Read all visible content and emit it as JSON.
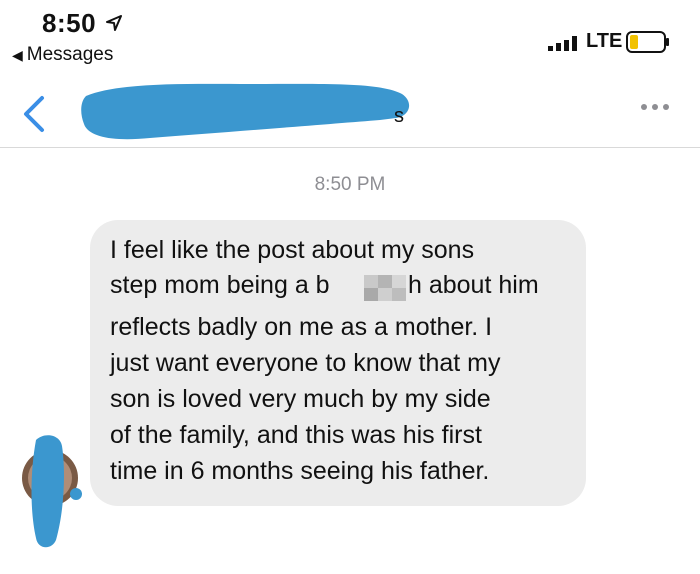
{
  "status_bar": {
    "time": "8:50",
    "back_app": "Messages",
    "carrier": "LTE"
  },
  "nav": {
    "contact_name": "",
    "more_icon": "ellipsis-icon",
    "back_icon": "chevron-left-icon"
  },
  "conversation": {
    "timestamp": "8:50 PM",
    "message_lines": [
      "I feel like the post about my sons",
      "step mom being a b",
      "h about him",
      "reflects badly on me as a mother. I",
      "just want everyone to know that my",
      "son is loved very much by my side",
      "of the family, and this was his first",
      "time in 6 months seeing his father."
    ]
  },
  "colors": {
    "accent": "#3a8ee6",
    "redaction": "#3b97cf",
    "bubble": "#ececec",
    "timestamp": "#8e8e93"
  }
}
